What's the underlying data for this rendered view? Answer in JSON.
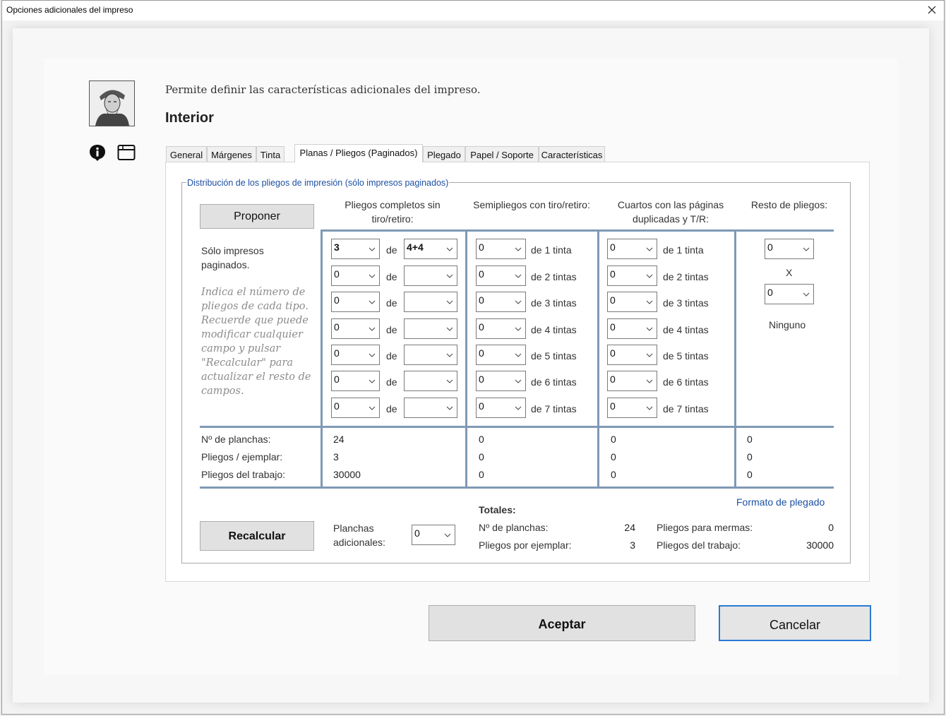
{
  "window": {
    "title": "Opciones adicionales del impreso"
  },
  "header": {
    "description": "Permite definir las características adicionales del impreso.",
    "heading": "Interior"
  },
  "tabs": [
    {
      "label": "General",
      "active": false
    },
    {
      "label": "Márgenes",
      "active": false
    },
    {
      "label": "Tinta",
      "active": false
    },
    {
      "label": "Planas / Pliegos  (Paginados)",
      "active": true
    },
    {
      "label": "Plegado",
      "active": false
    },
    {
      "label": "Papel / Soporte",
      "active": false
    },
    {
      "label": "Características",
      "active": false
    }
  ],
  "group": {
    "legend": "Distribución de los pliegos de impresión (sólo impresos paginados)",
    "propose_label": "Proponer",
    "only_label": "Sólo impresos paginados.",
    "hint": "Indica el número de pliegos de cada tipo. Recuerde que puede modificar cualquier campo y pulsar \"Recalcular\" para actualizar el resto de campos.",
    "columns": {
      "full": "Pliegos completos sin tiro/retiro:",
      "semi": "Semipliegos con tiro/retiro:",
      "quarters": "Cuartos con las páginas duplicadas y T/R:",
      "rest": "Resto de pliegos:"
    },
    "de_label": "de",
    "full_rows": [
      {
        "count": "3",
        "type": "4+4"
      },
      {
        "count": "0",
        "type": ""
      },
      {
        "count": "0",
        "type": ""
      },
      {
        "count": "0",
        "type": ""
      },
      {
        "count": "0",
        "type": ""
      },
      {
        "count": "0",
        "type": ""
      },
      {
        "count": "0",
        "type": ""
      }
    ],
    "ink_labels": [
      "de 1 tinta",
      "de 2 tintas",
      "de 3 tintas",
      "de 4 tintas",
      "de 5 tintas",
      "de 6 tintas",
      "de 7 tintas"
    ],
    "semi_values": [
      "0",
      "0",
      "0",
      "0",
      "0",
      "0",
      "0"
    ],
    "quarter_values": [
      "0",
      "0",
      "0",
      "0",
      "0",
      "0",
      "0"
    ],
    "rest": {
      "a": "0",
      "x": "X",
      "b": "0",
      "none": "Ninguno"
    },
    "stats_labels": [
      "Nº de planchas:",
      "Pliegos / ejemplar:",
      "Pliegos del trabajo:"
    ],
    "stats": {
      "full": [
        "24",
        "3",
        "30000"
      ],
      "semi": [
        "0",
        "0",
        "0"
      ],
      "quarters": [
        "0",
        "0",
        "0"
      ],
      "rest": [
        "0",
        "0",
        "0"
      ]
    },
    "folding_link": "Formato de plegado",
    "recalc_label": "Recalcular",
    "extra_plates_label": "Planchas adicionales:",
    "extra_plates_value": "0",
    "totals": {
      "title": "Totales:",
      "plates_label": "Nº de planchas:",
      "plates_value": "24",
      "per_copy_label": "Pliegos por ejemplar:",
      "per_copy_value": "3",
      "waste_label": "Pliegos para mermas:",
      "waste_value": "0",
      "job_label": "Pliegos del trabajo:",
      "job_value": "30000"
    }
  },
  "footer": {
    "accept": "Aceptar",
    "cancel": "Cancelar"
  }
}
